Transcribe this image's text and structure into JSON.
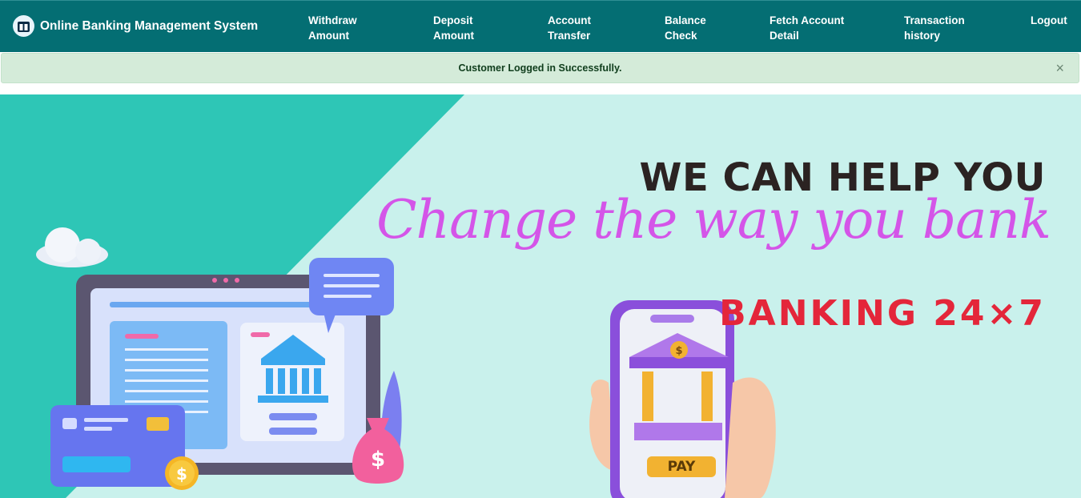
{
  "brand": {
    "title": "Online Banking Management System",
    "logo_icon": "bank-building-icon"
  },
  "nav": {
    "withdraw": [
      "Withdraw",
      "Amount"
    ],
    "deposit": [
      "Deposit",
      "Amount"
    ],
    "transfer": [
      "Account",
      "Transfer"
    ],
    "balance": [
      "Balance",
      "Check"
    ],
    "fetch": [
      "Fetch Account",
      "Detail"
    ],
    "history": [
      "Transaction",
      "history"
    ],
    "logout": "Logout"
  },
  "alert": {
    "message": "Customer Logged in Successfully.",
    "close_icon": "close-icon"
  },
  "banner": {
    "headline": "WE CAN HELP YOU",
    "tagline": "Change the way you bank",
    "subline": "BANKING 24×7",
    "pay_label": "PAY",
    "coin_symbol": "$"
  },
  "colors": {
    "navbar": "#046e73",
    "alert_bg": "#d4ebd9",
    "banner_teal": "#2ec6b6",
    "banner_light": "#c9f1ec",
    "headline": "#2b2322",
    "tagline": "#d455e8",
    "subline": "#e4263a"
  }
}
